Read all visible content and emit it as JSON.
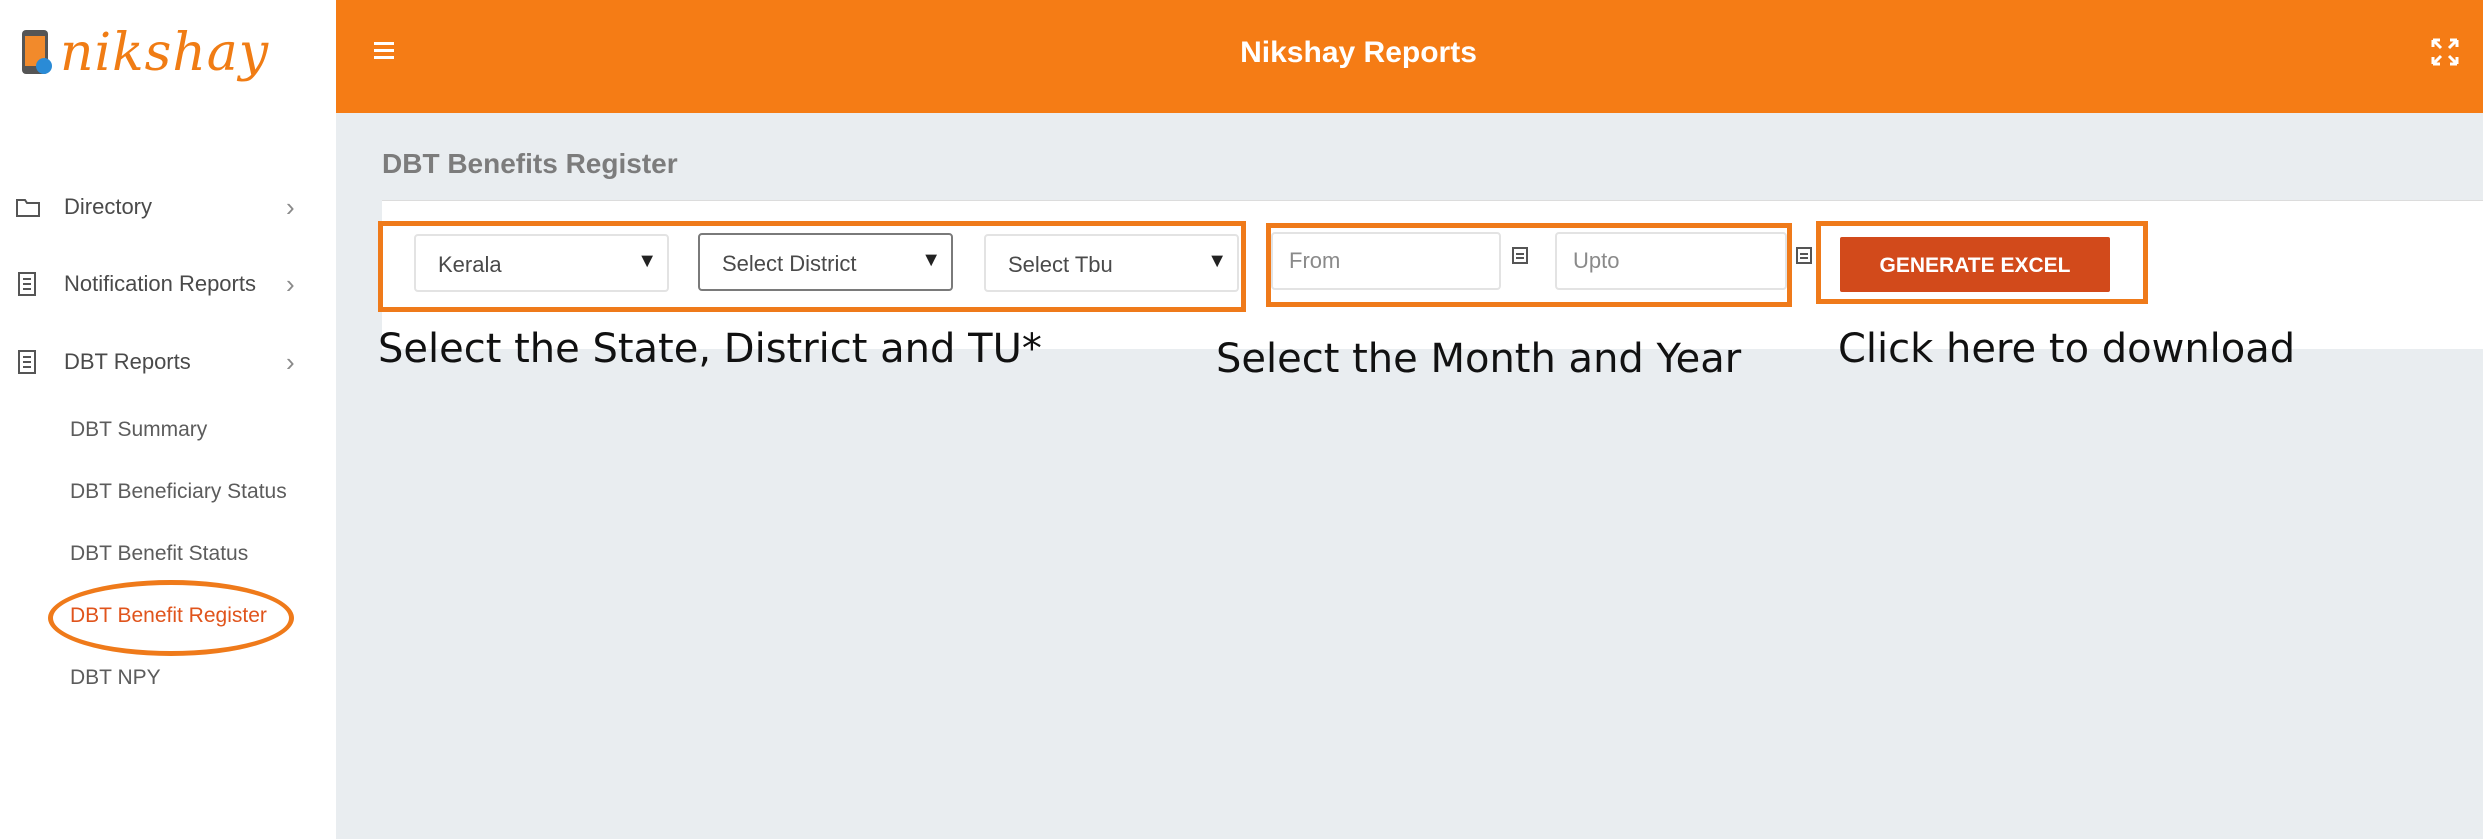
{
  "app": {
    "logo_text": "nikshay",
    "title": "Nikshay Reports"
  },
  "sidebar": {
    "items": [
      {
        "label": "Directory",
        "icon": "folder-icon"
      },
      {
        "label": "Notification Reports",
        "icon": "document-icon"
      },
      {
        "label": "DBT Reports",
        "icon": "document-icon"
      }
    ],
    "sub_items": [
      {
        "label": "DBT Summary",
        "active": false
      },
      {
        "label": "DBT Beneficiary Status",
        "active": false
      },
      {
        "label": "DBT Benefit Status",
        "active": false
      },
      {
        "label": "DBT Benefit Register",
        "active": true
      },
      {
        "label": "DBT NPY",
        "active": false
      }
    ]
  },
  "main": {
    "page_title": "DBT Benefits Register",
    "filters": {
      "state": "Kerala",
      "district": "Select District",
      "tbu": "Select Tbu",
      "from_placeholder": "From",
      "upto_placeholder": "Upto"
    },
    "generate_button": "GENERATE EXCEL"
  },
  "annotations": {
    "select_location": "Select the State, District and TU*",
    "select_month": "Select the Month and Year",
    "click_download": "Click here to download"
  },
  "colors": {
    "brand_orange": "#f57c15",
    "button_red": "#d24a1b",
    "highlight": "#ef7a1a",
    "active_link": "#e0541c"
  }
}
